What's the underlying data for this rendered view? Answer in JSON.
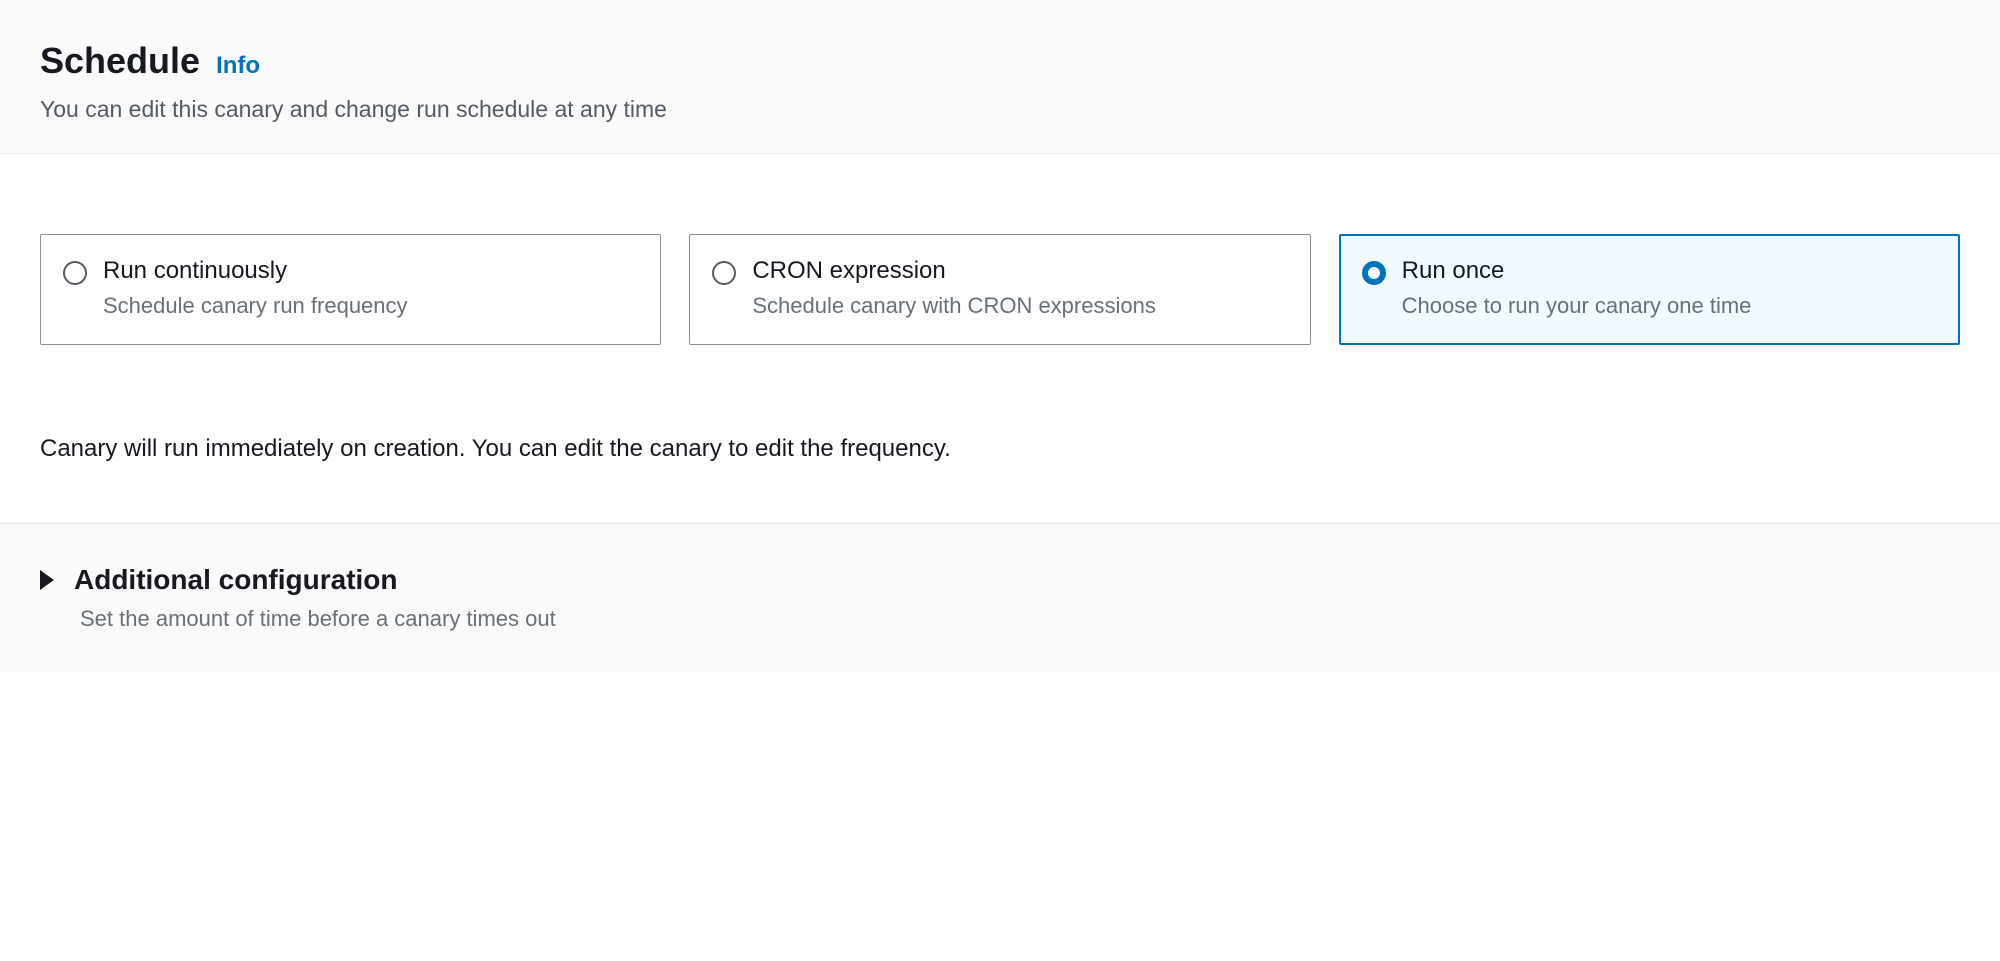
{
  "header": {
    "title": "Schedule",
    "info_link": "Info",
    "subtitle": "You can edit this canary and change run schedule at any time"
  },
  "options": [
    {
      "title": "Run continuously",
      "description": "Schedule canary run frequency",
      "selected": false
    },
    {
      "title": "CRON expression",
      "description": "Schedule canary with CRON expressions",
      "selected": false
    },
    {
      "title": "Run once",
      "description": "Choose to run your canary one time",
      "selected": true
    }
  ],
  "selection_note": "Canary will run immediately on creation. You can edit the canary to edit the frequency.",
  "additional": {
    "title": "Additional configuration",
    "subtitle": "Set the amount of time before a canary times out"
  }
}
